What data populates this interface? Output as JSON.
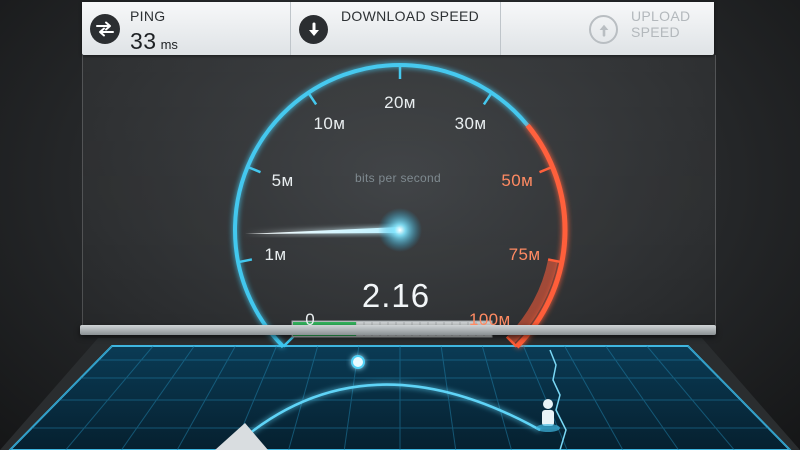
{
  "header": {
    "ping": {
      "label": "PING",
      "value": "33",
      "unit": "ms",
      "icon": "ping-arrows-icon"
    },
    "download": {
      "label": "DOWNLOAD SPEED",
      "icon": "download-arrow-icon"
    },
    "upload": {
      "label": "UPLOAD SPEED",
      "icon": "upload-arrow-icon",
      "state": "inactive"
    }
  },
  "gauge": {
    "unit_caption": "bits per second",
    "current_value": "2.16",
    "needle_value_mbps": 2.16,
    "ticks": [
      {
        "label": "0",
        "hot": false
      },
      {
        "label": "1м",
        "hot": false
      },
      {
        "label": "5м",
        "hot": false
      },
      {
        "label": "10м",
        "hot": false
      },
      {
        "label": "20м",
        "hot": false
      },
      {
        "label": "30м",
        "hot": false
      },
      {
        "label": "50м",
        "hot": true
      },
      {
        "label": "75м",
        "hot": true
      },
      {
        "label": "100м",
        "hot": true
      }
    ],
    "colors": {
      "cool": "#3cc6ee",
      "hot": "#ff5a34"
    }
  },
  "progress": {
    "fraction": 0.32,
    "color": "#2fb35a"
  }
}
